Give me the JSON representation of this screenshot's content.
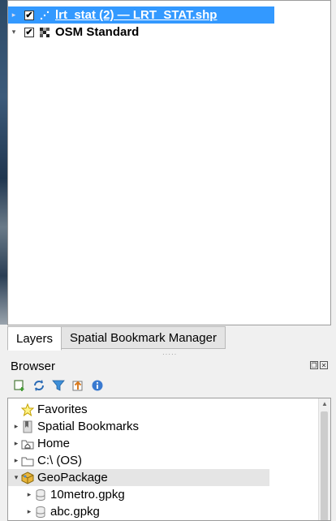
{
  "layers": [
    {
      "name": "lrt_stat (2) — LRT_STAT.shp",
      "checked": "✔",
      "expander": "▸",
      "icon": "point-layer-icon"
    },
    {
      "name": "OSM Standard",
      "checked": "✔",
      "expander": "▾",
      "icon": "raster-tile-icon"
    }
  ],
  "tabs": [
    {
      "label": "Layers"
    },
    {
      "label": "Spatial Bookmark Manager"
    }
  ],
  "browser": {
    "title": "Browser",
    "float_icons": {
      "restore": "❐",
      "close": "✕"
    },
    "tree": [
      {
        "label": "Favorites",
        "expander": "",
        "icon": "star-icon"
      },
      {
        "label": "Spatial Bookmarks",
        "expander": "▸",
        "icon": "bookmark-icon"
      },
      {
        "label": "Home",
        "expander": "▸",
        "icon": "home-folder-icon"
      },
      {
        "label": "C:\\ (OS)",
        "expander": "▸",
        "icon": "folder-icon"
      },
      {
        "label": "GeoPackage",
        "expander": "▾",
        "icon": "geopackage-icon"
      },
      {
        "label": "10metro.gpkg",
        "expander": "▸",
        "icon": "database-icon"
      },
      {
        "label": "abc.gpkg",
        "expander": "▸",
        "icon": "database-icon"
      }
    ]
  },
  "colors": {
    "selection": "#3399ff",
    "highlight": "#e5e5e5"
  }
}
